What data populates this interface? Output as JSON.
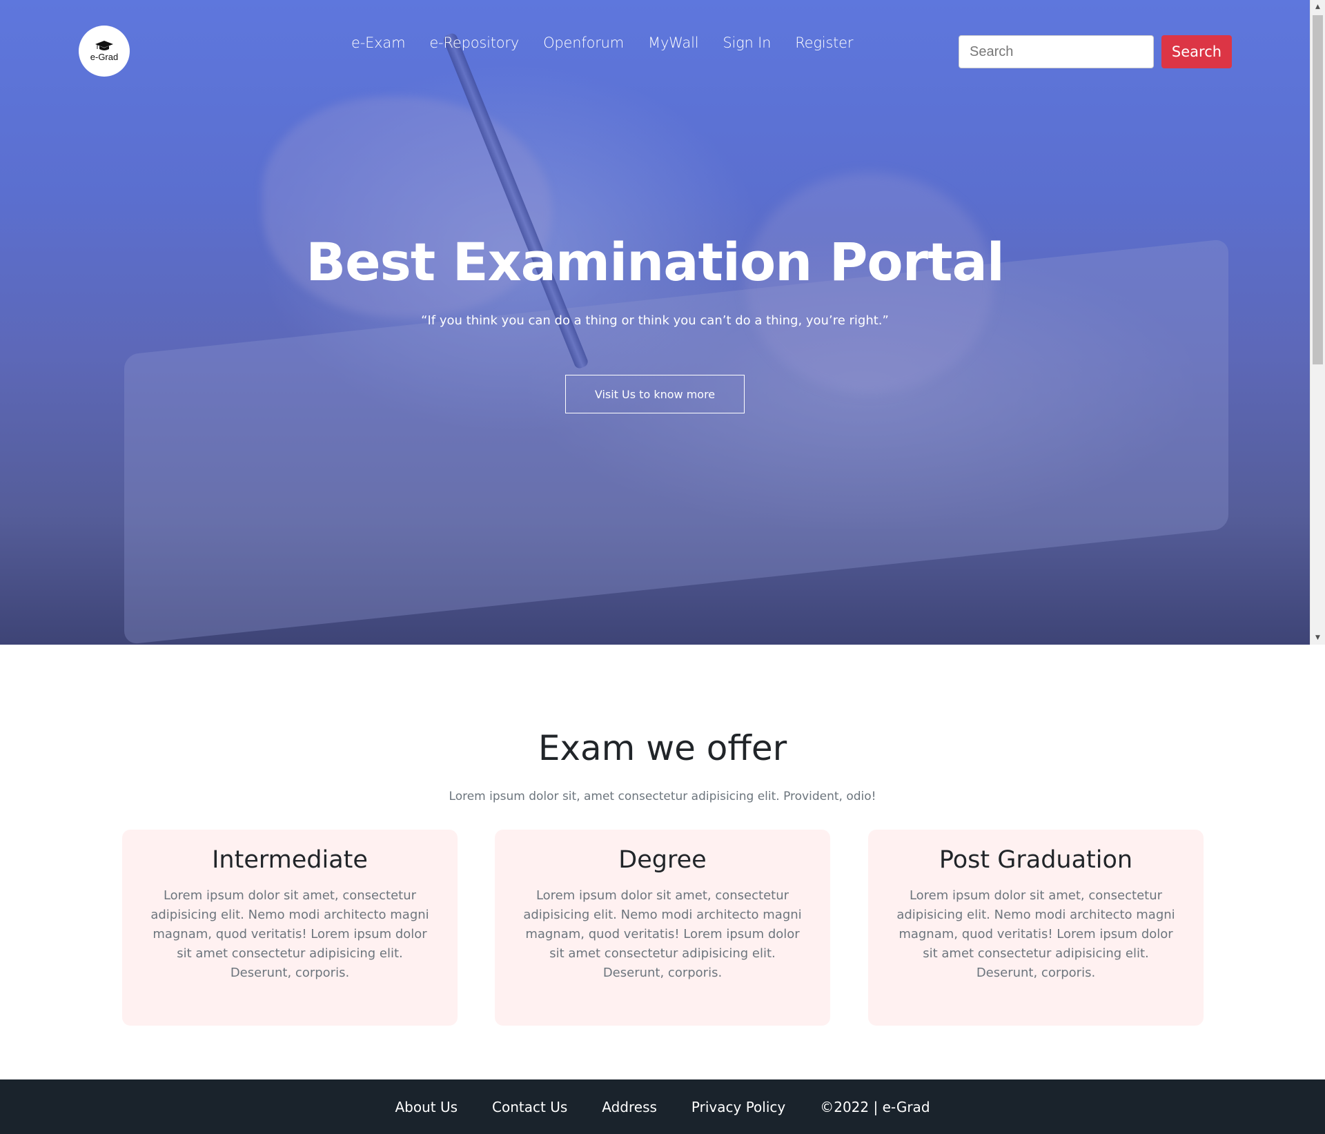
{
  "brand": {
    "logo_text": "e-Grad",
    "logo_icon": "graduation-cap-icon"
  },
  "nav": {
    "items": [
      {
        "label": "e-Exam"
      },
      {
        "label": "e-Repository"
      },
      {
        "label": "Openforum"
      },
      {
        "label": "MyWall"
      },
      {
        "label": "Sign In"
      },
      {
        "label": "Register"
      }
    ]
  },
  "search": {
    "placeholder": "Search",
    "value": "",
    "button_label": "Search",
    "button_color": "#dc3545"
  },
  "hero": {
    "title": "Best Examination Portal",
    "quote": "“If you think you can do a thing or think you can’t do a thing, you’re right.”",
    "cta_label": "Visit Us to know more",
    "overlay_color": "#5b6fcf"
  },
  "offers": {
    "title": "Exam we offer",
    "subtitle": "Lorem ipsum dolor sit, amet consectetur adipisicing elit. Provident, odio!",
    "cards": [
      {
        "title": "Intermediate",
        "text": "Lorem ipsum dolor sit amet, consectetur adipisicing elit. Nemo modi architecto magni magnam, quod veritatis! Lorem ipsum dolor sit amet consectetur adipisicing elit. Deserunt, corporis."
      },
      {
        "title": "Degree",
        "text": "Lorem ipsum dolor sit amet, consectetur adipisicing elit. Nemo modi architecto magni magnam, quod veritatis! Lorem ipsum dolor sit amet consectetur adipisicing elit. Deserunt, corporis."
      },
      {
        "title": "Post Graduation",
        "text": "Lorem ipsum dolor sit amet, consectetur adipisicing elit. Nemo modi architecto magni magnam, quod veritatis! Lorem ipsum dolor sit amet consectetur adipisicing elit. Deserunt, corporis."
      }
    ],
    "card_bg": "#fff1f1"
  },
  "footer": {
    "links": [
      {
        "label": "About Us"
      },
      {
        "label": "Contact Us"
      },
      {
        "label": "Address"
      },
      {
        "label": "Privacy Policy"
      }
    ],
    "copyright": "©2022 | e-Grad",
    "bg_color": "#1a232c"
  }
}
